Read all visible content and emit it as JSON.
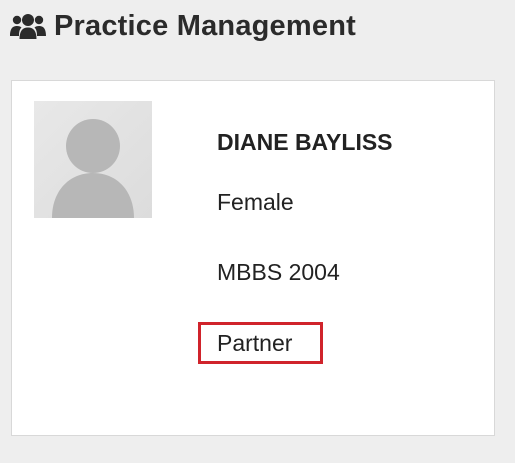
{
  "header": {
    "icon": "users-icon",
    "title": "Practice Management"
  },
  "profile": {
    "avatar_icon": "user-placeholder-icon",
    "name": "DIANE BAYLISS",
    "gender": "Female",
    "qualification": "MBBS 2004",
    "role": "Partner"
  },
  "colors": {
    "background": "#eeeeee",
    "card": "#ffffff",
    "highlight_border": "#d0232b",
    "avatar": "#b7b7b7"
  }
}
